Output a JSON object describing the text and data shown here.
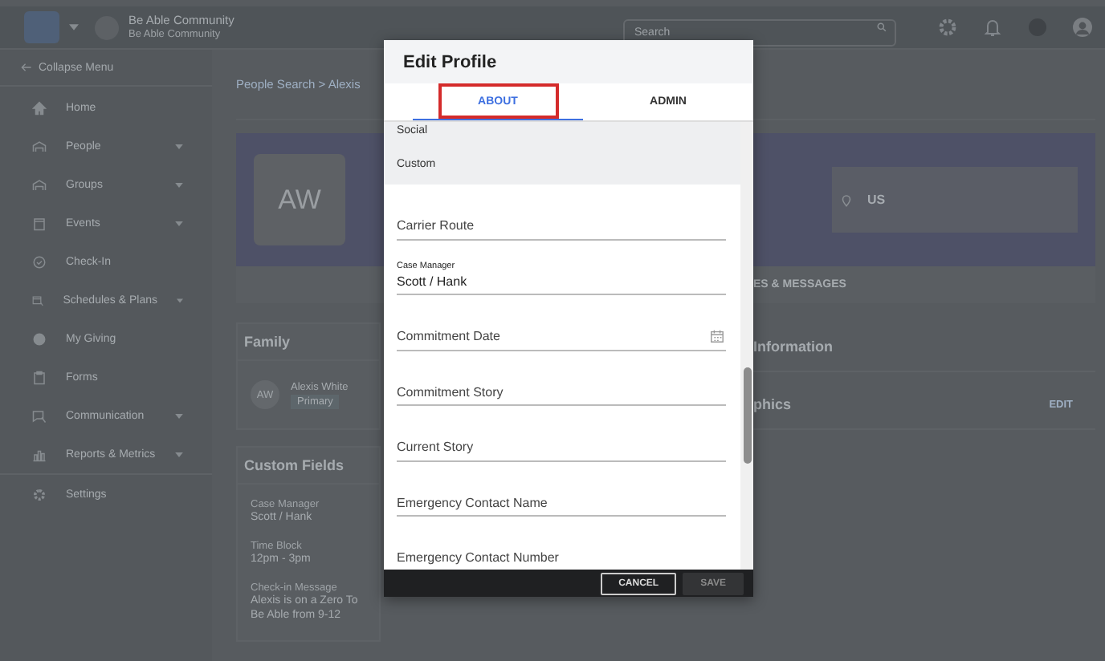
{
  "top_bar": {
    "organization": "Be Able Community",
    "organization_subtitle": "Be Able Community",
    "search": {
      "placeholder": "Search"
    }
  },
  "sidebar": {
    "collapse": "Collapse Menu",
    "items": [
      {
        "label": "Home",
        "expandable": false
      },
      {
        "label": "People",
        "expandable": true
      },
      {
        "label": "Groups",
        "expandable": true
      },
      {
        "label": "Events",
        "expandable": true
      },
      {
        "label": "Check-In",
        "expandable": false
      },
      {
        "label": "Schedules & Plans",
        "expandable": true
      },
      {
        "label": "My Giving",
        "expandable": false
      },
      {
        "label": "Forms",
        "expandable": false
      },
      {
        "label": "Communication",
        "expandable": true
      },
      {
        "label": "Reports & Metrics",
        "expandable": true
      },
      {
        "label": "Settings",
        "expandable": false
      }
    ]
  },
  "breadcrumb": "People Search > Alexis",
  "profile": {
    "initials": "AW",
    "location": "US"
  },
  "tab_strip_fragment": "ES & MESSAGES",
  "family": {
    "title": "Family",
    "members": [
      {
        "initials": "AW",
        "name": "Alexis White",
        "tag": "Primary"
      }
    ]
  },
  "custom_fields": {
    "title": "Custom Fields",
    "fields": [
      {
        "label": "Case Manager",
        "lines": [
          "Scott / Hank"
        ]
      },
      {
        "label": "Time Block",
        "lines": [
          "12pm - 3pm"
        ]
      },
      {
        "label": "Check-in Message",
        "lines": [
          "Alexis is on a Zero To",
          "Be Able from 9-12"
        ]
      }
    ]
  },
  "right_cards": [
    {
      "title": "Information"
    },
    {
      "title": "phics",
      "action": "EDIT"
    }
  ],
  "modal": {
    "title": "Edit Profile",
    "tabs": [
      {
        "label": "ABOUT",
        "selected": true,
        "highlighted": true
      },
      {
        "label": "ADMIN",
        "selected": false,
        "highlighted": false
      }
    ],
    "sections": [
      "Social",
      "Custom"
    ],
    "fields": [
      {
        "kind": "text",
        "placeholder": "Carrier Route"
      },
      {
        "kind": "text",
        "label": "Case Manager",
        "value": "Scott / Hank"
      },
      {
        "kind": "date",
        "placeholder": "Commitment Date"
      },
      {
        "kind": "text",
        "placeholder": "Commitment Story"
      },
      {
        "kind": "text",
        "placeholder": "Current Story"
      },
      {
        "kind": "text",
        "placeholder": "Emergency Contact Name"
      },
      {
        "kind": "text",
        "placeholder": "Emergency Contact Number"
      }
    ],
    "buttons": [
      {
        "label": "CANCEL",
        "disabled": false
      },
      {
        "label": "SAVE",
        "disabled": true
      }
    ]
  }
}
